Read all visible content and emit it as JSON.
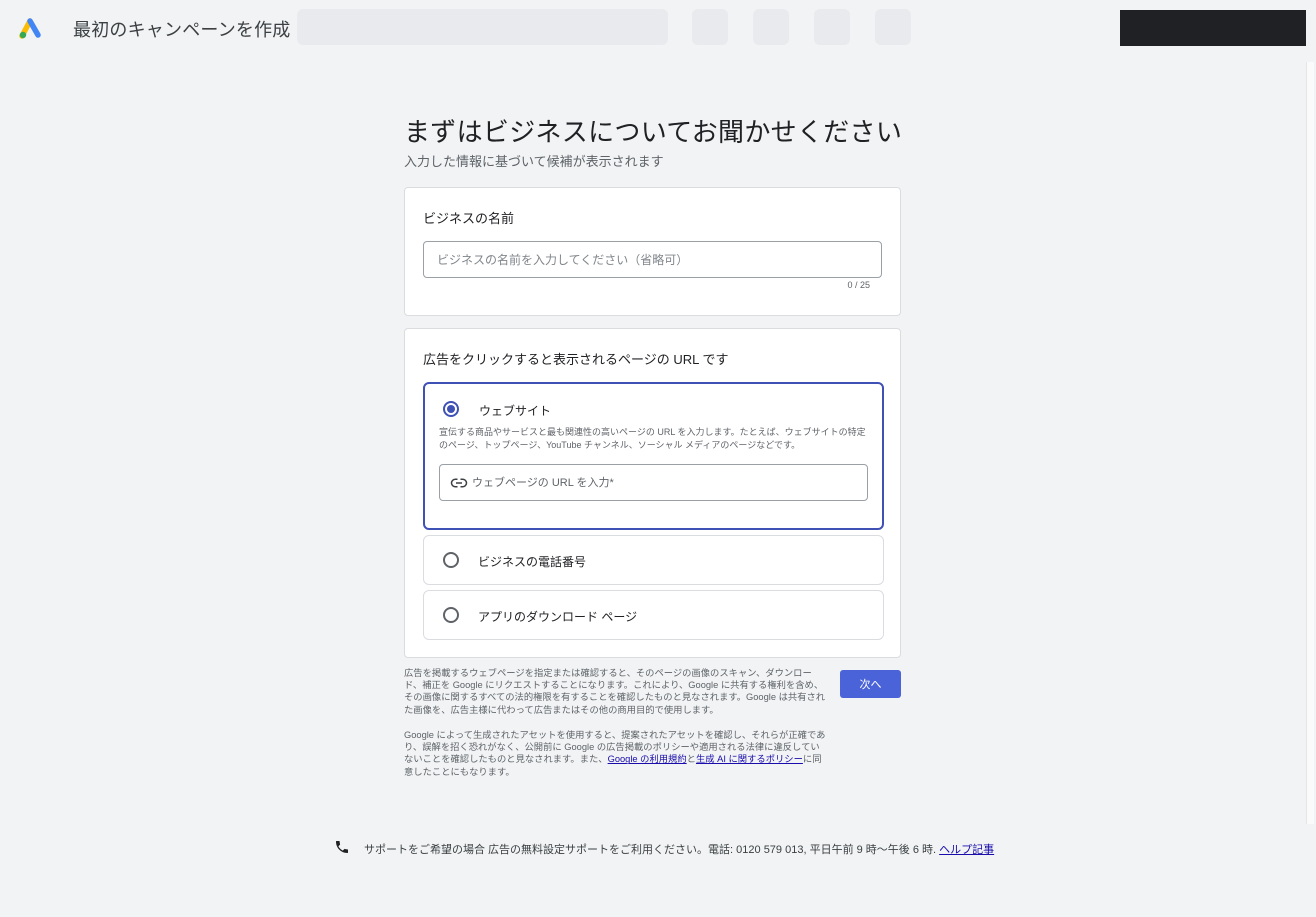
{
  "header": {
    "title": "最初のキャンペーンを作成"
  },
  "main": {
    "title": "まずはビジネスについてお聞かせください",
    "subtitle": "入力した情報に基づいて候補が表示されます"
  },
  "business_name": {
    "label": "ビジネスの名前",
    "placeholder": "ビジネスの名前を入力してください（省略可）",
    "value": "",
    "counter": "0 / 25"
  },
  "url_section": {
    "label": "広告をクリックすると表示されるページの URL です",
    "options": [
      {
        "label": "ウェブサイト",
        "selected": true,
        "description": "宣伝する商品やサービスと最も関連性の高いページの URL を入力します。たとえば、ウェブサイトの特定のページ、トップページ、YouTube チャンネル、ソーシャル メディアのページなどです。",
        "input_placeholder": "ウェブページの URL を入力*"
      },
      {
        "label": "ビジネスの電話番号",
        "selected": false
      },
      {
        "label": "アプリのダウンロード ページ",
        "selected": false
      }
    ]
  },
  "disclaimer": {
    "para1": "広告を掲載するウェブページを指定または確認すると、そのページの画像のスキャン、ダウンロード、補正を Google にリクエストすることになります。これにより、Google に共有する権利を含め、その画像に関するすべての法的権限を有することを確認したものと見なされます。Google は共有された画像を、広告主様に代わって広告またはその他の商用目的で使用します。",
    "para2_prefix": "Google によって生成されたアセットを使用すると、提案されたアセットを確認し、それらが正確であり、誤解を招く恐れがなく、公開前に Google の広告掲載のポリシーや適用される法律に違反していないことを確認したものと見なされます。また、",
    "terms_link": "Google の利用規約",
    "and_text": "と",
    "policy_link": "生成 AI に関するポリシー",
    "para2_suffix": "に同意したことにもなります。"
  },
  "next_button": "次へ",
  "support": {
    "text": "サポートをご希望の場合 広告の無料設定サポートをご利用ください。電話: 0120 579 013, 平日午前 9 時〜午後 6 時. ",
    "help_link": "ヘルプ記事"
  },
  "colors": {
    "accent": "#3f51b5",
    "button": "#4b63d8",
    "background": "#f1f3f4",
    "link": "#1a0dab"
  },
  "icons": [
    "google-ads-logo",
    "link-icon",
    "phone-icon"
  ]
}
